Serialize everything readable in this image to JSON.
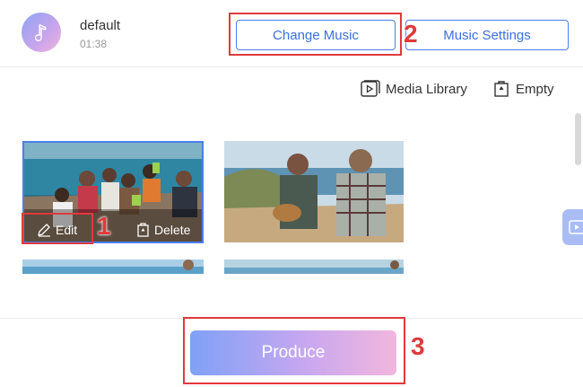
{
  "music": {
    "track_name": "default",
    "duration": "01:38",
    "change_label": "Change Music",
    "settings_label": "Music Settings"
  },
  "toolbar": {
    "media_library_label": "Media Library",
    "empty_label": "Empty"
  },
  "clip": {
    "edit_label": "Edit",
    "delete_label": "Delete"
  },
  "footer": {
    "produce_label": "Produce"
  },
  "annotations": {
    "step1": "1",
    "step2": "2",
    "step3": "3"
  },
  "colors": {
    "accent": "#4a7ef0",
    "highlight": "#e0393c"
  }
}
